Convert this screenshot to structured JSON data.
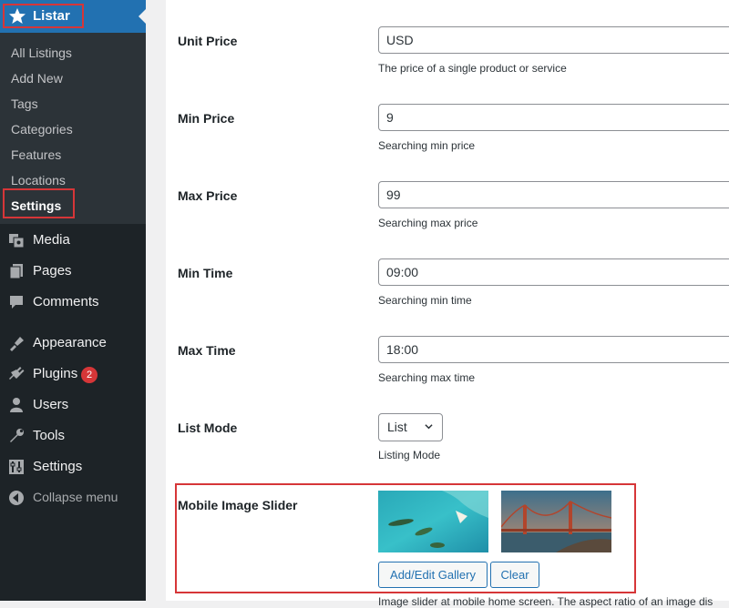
{
  "sidebar": {
    "active_menu": {
      "label": "Listar",
      "icon": "star-icon"
    },
    "submenu": [
      "All Listings",
      "Add New",
      "Tags",
      "Categories",
      "Features",
      "Locations",
      "Settings"
    ],
    "current_submenu": "Settings",
    "menu": [
      {
        "label": "Media",
        "icon": "media-icon"
      },
      {
        "label": "Pages",
        "icon": "pages-icon"
      },
      {
        "label": "Comments",
        "icon": "comments-icon"
      },
      {
        "label": "Appearance",
        "icon": "appearance-icon"
      },
      {
        "label": "Plugins",
        "icon": "plugins-icon",
        "badge": "2"
      },
      {
        "label": "Users",
        "icon": "users-icon"
      },
      {
        "label": "Tools",
        "icon": "tools-icon"
      },
      {
        "label": "Settings",
        "icon": "settings-icon"
      },
      {
        "label": "Collapse menu",
        "icon": "collapse-icon"
      }
    ]
  },
  "form": {
    "unit_price": {
      "label": "Unit Price",
      "value": "USD",
      "description": "The price of a single product or service"
    },
    "min_price": {
      "label": "Min Price",
      "value": "9",
      "description": "Searching min price"
    },
    "max_price": {
      "label": "Max Price",
      "value": "99",
      "description": "Searching max price"
    },
    "min_time": {
      "label": "Min Time",
      "value": "09:00",
      "description": "Searching min time"
    },
    "max_time": {
      "label": "Max Time",
      "value": "18:00",
      "description": "Searching max time"
    },
    "list_mode": {
      "label": "List Mode",
      "value": "List",
      "description": "Listing Mode"
    },
    "mobile_slider": {
      "label": "Mobile Image Slider",
      "add_edit_label": "Add/Edit Gallery",
      "clear_label": "Clear",
      "description": "Image slider at mobile home screen. The aspect ratio of an image dis"
    }
  },
  "colors": {
    "sidebar_bg": "#1d2327",
    "active_blue": "#2271b1",
    "highlight_red": "#d63638",
    "badge_red": "#d63638"
  }
}
